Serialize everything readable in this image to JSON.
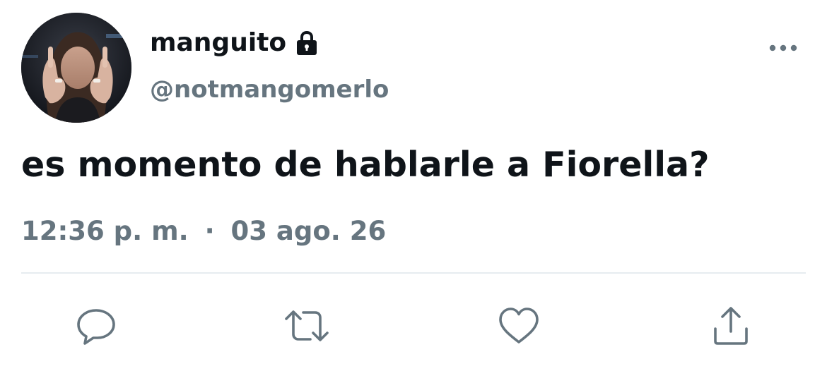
{
  "tweet": {
    "author": {
      "display_name": "manguito",
      "handle": "@notmangomerlo",
      "protected_icon": "lock-icon",
      "avatar": "profile-photo"
    },
    "text": "es momento de hablarle a Fiorella?",
    "time": "12:36 p. m.",
    "separator": "·",
    "date": "03 ago. 26",
    "more_icon": "more-icon",
    "actions": [
      {
        "name": "reply",
        "icon": "reply-icon"
      },
      {
        "name": "retweet",
        "icon": "retweet-icon"
      },
      {
        "name": "like",
        "icon": "heart-icon"
      },
      {
        "name": "share",
        "icon": "share-icon"
      }
    ]
  },
  "colors": {
    "text_primary": "#0f1419",
    "text_secondary": "#66757f",
    "icon": "#66757f",
    "divider": "#e6ecf0",
    "background": "#ffffff"
  }
}
